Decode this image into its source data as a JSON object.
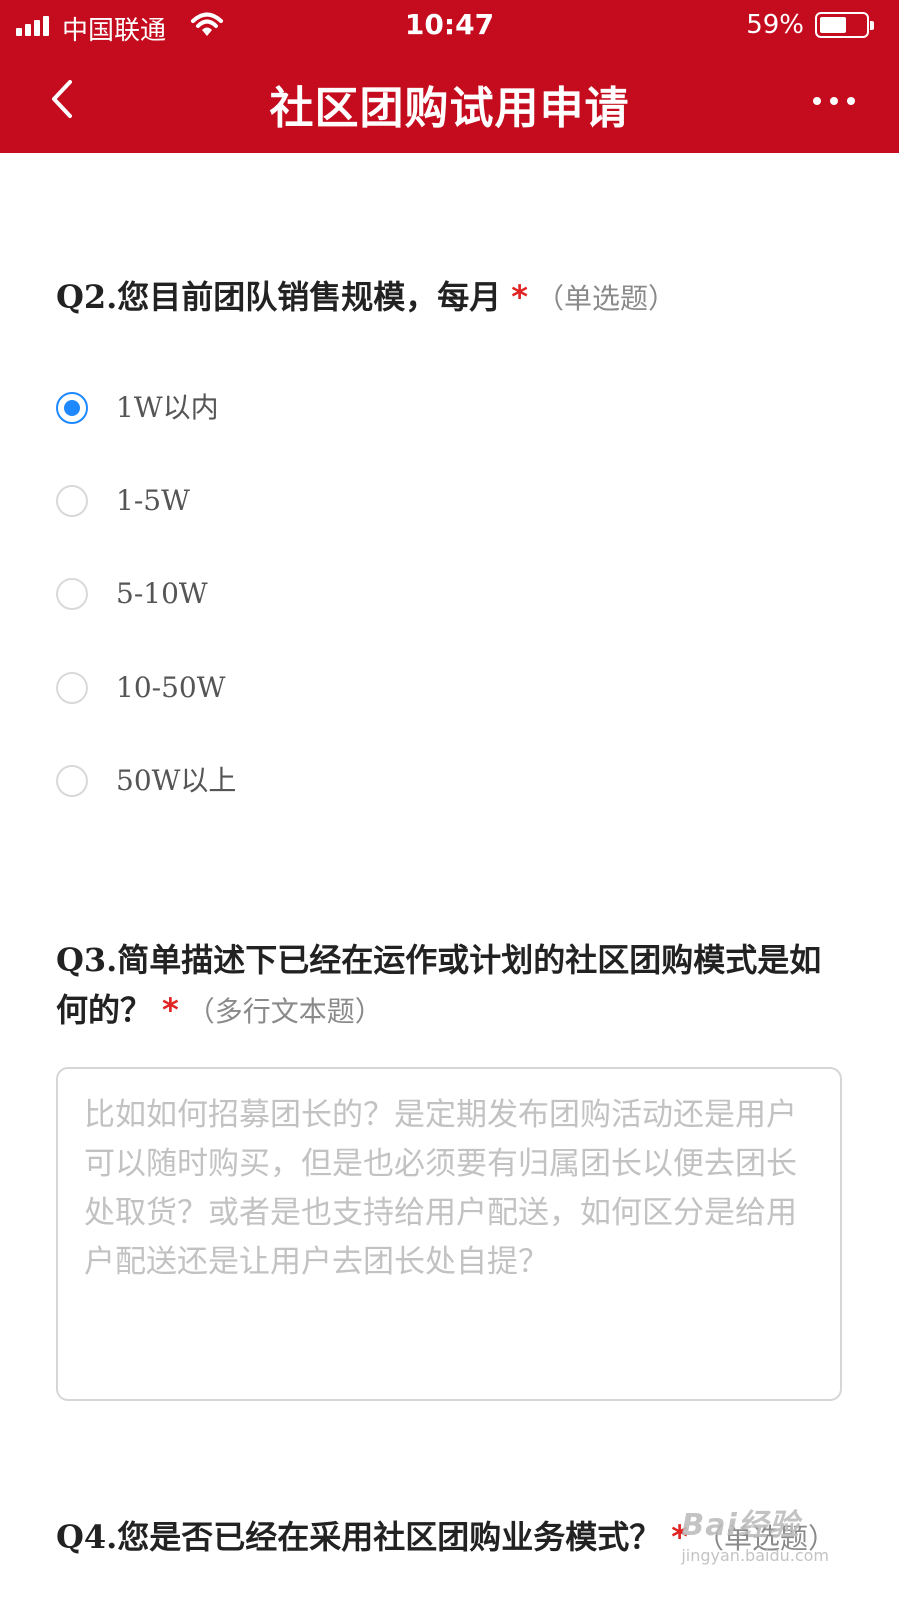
{
  "status_bar": {
    "carrier": "中国联通",
    "time": "10:47",
    "battery_percent": "59%",
    "battery_level": 0.59
  },
  "nav": {
    "title": "社区团购试用申请",
    "back_icon": "chevron-left-icon",
    "more_icon": "more-horizontal-icon"
  },
  "colors": {
    "header": "#c50c1e",
    "radio_selected": "#1e88ff",
    "required": "#e02424"
  },
  "q2": {
    "title": "Q2.您目前团队销售规模，每月",
    "required_mark": "*",
    "type": "（单选题）",
    "options": [
      "1W以内",
      "1-5W",
      "5-10W",
      "10-50W",
      "50W以上"
    ],
    "selected": "1W以内"
  },
  "q3": {
    "title": "Q3.简单描述下已经在运作或计划的社区团购模式是如何的？",
    "required_mark": "*",
    "type": "（多行文本题）",
    "placeholder": "比如如何招募团长的？是定期发布团购活动还是用户可以随时购买，但是也必须要有归属团长以便去团长处取货？或者是也支持给用户配送，如何区分是给用户配送还是让用户去团长处自提？"
  },
  "q4": {
    "title": "Q4.您是否已经在采用社区团购业务模式？",
    "required_mark": "*",
    "type": "（单选题）"
  },
  "watermark": {
    "main": "Bai经验",
    "sub": "jingyan.baidu.com"
  }
}
